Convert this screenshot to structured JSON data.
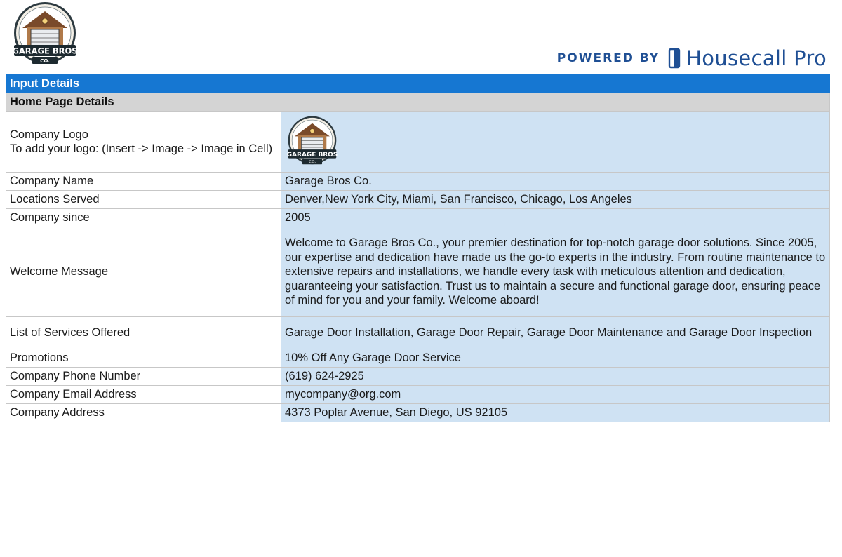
{
  "header": {
    "logo_name": "garage-bros-logo",
    "logo_text": "GARAGE BROS",
    "logo_subtext": "CO.",
    "powered_by": "POWERED BY",
    "brand": "Housecall Pro"
  },
  "table": {
    "section_title": "Input Details",
    "subsection_title": "Home Page Details",
    "logo_row": {
      "label_line1": "Company Logo",
      "label_line2": "To add your logo: (Insert -> Image -> Image in Cell)"
    },
    "rows": [
      {
        "label": "Company Name",
        "value": "Garage Bros Co."
      },
      {
        "label": "Locations Served",
        "value": "Denver,New York City, Miami, San Francisco, Chicago, Los Angeles"
      },
      {
        "label": "Company since",
        "value": "2005"
      },
      {
        "label": "Welcome Message",
        "value": "Welcome to Garage Bros Co., your premier destination for top-notch garage door solutions. Since 2005, our expertise and dedication have made us the go-to experts in the industry. From routine maintenance to extensive repairs and installations, we handle every task with meticulous attention and dedication, guaranteeing your satisfaction. Trust us to maintain a secure and functional garage door, ensuring peace of mind for you and your family. Welcome aboard!"
      },
      {
        "label": "List of Services Offered",
        "value": "Garage Door Installation, Garage Door Repair, Garage Door Maintenance and Garage Door Inspection"
      },
      {
        "label": "Promotions",
        "value": "10% Off Any Garage Door Service"
      },
      {
        "label": "Company Phone Number",
        "value": "(619) 624-2925"
      },
      {
        "label": "Company Email Address",
        "value": "mycompany@org.com"
      },
      {
        "label": "Company Address",
        "value": "4373 Poplar Avenue, San Diego, US 92105"
      }
    ]
  },
  "colors": {
    "section_blue": "#1677d2",
    "section_gray": "#d4d4d4",
    "value_fill": "#cfe2f3",
    "brand_blue": "#1f4f94"
  }
}
